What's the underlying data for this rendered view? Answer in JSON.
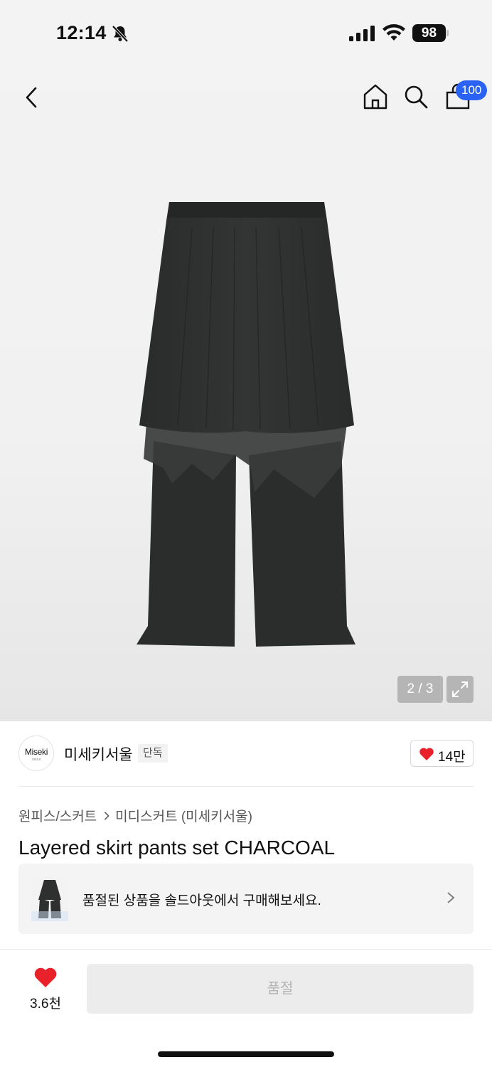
{
  "status_bar": {
    "time": "12:14",
    "battery": "98"
  },
  "nav": {
    "cart_badge": "100",
    "icons": [
      "back-icon",
      "home-icon",
      "search-icon",
      "shopping-bag-icon"
    ]
  },
  "gallery": {
    "counter": "2 / 3"
  },
  "brand": {
    "logo_text": "Miseki",
    "logo_subtext": "seoul",
    "name": "미세키서울",
    "exclusive_tag": "단독",
    "likes": "14만"
  },
  "breadcrumb": {
    "category": "원피스/스커트",
    "subcategory": "미디스커트 (미세키서울)"
  },
  "product": {
    "title": "Layered skirt pants set CHARCOAL"
  },
  "soldout_card": {
    "text": "품절된 상품을 솔드아웃에서 구매해보세요."
  },
  "bottom_bar": {
    "wish_count": "3.6천",
    "purchase_label": "품절"
  },
  "colors": {
    "accent": "#2a63f3",
    "heart": "#e8212b",
    "garment": "#2d2f2f"
  }
}
